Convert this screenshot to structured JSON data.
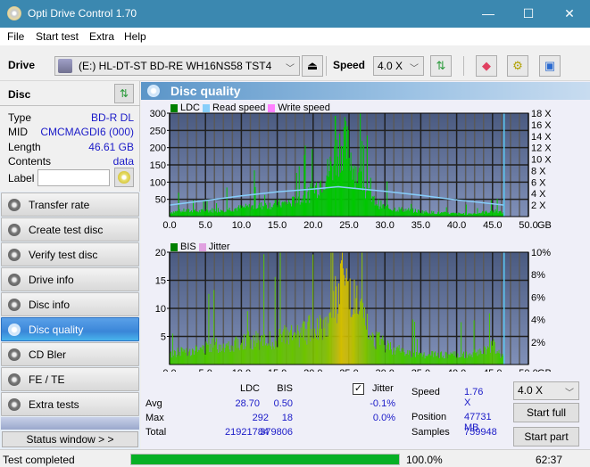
{
  "window": {
    "title": "Opti Drive Control 1.70",
    "minimize": "—",
    "maximize": "☐",
    "close": "✕"
  },
  "menu": [
    "File",
    "Start test",
    "Extra",
    "Help"
  ],
  "toolbar": {
    "drive_label": "Drive",
    "drive_value": "(E:)  HL-DT-ST BD-RE  WH16NS58 TST4",
    "speed_label": "Speed",
    "speed_value": "4.0 X",
    "icons": [
      "eject-icon",
      "refresh-icon",
      "erase-icon",
      "settings-icon",
      "save-icon"
    ]
  },
  "disc": {
    "header": "Disc",
    "fields": [
      {
        "label": "Type",
        "value": "BD-R DL"
      },
      {
        "label": "MID",
        "value": "CMCMAGDI6 (000)"
      },
      {
        "label": "Length",
        "value": "46.61 GB"
      },
      {
        "label": "Contents",
        "value": "data"
      }
    ],
    "label_label": "Label",
    "label_value": ""
  },
  "nav": [
    {
      "label": "Transfer rate",
      "active": false
    },
    {
      "label": "Create test disc",
      "active": false
    },
    {
      "label": "Verify test disc",
      "active": false
    },
    {
      "label": "Drive info",
      "active": false
    },
    {
      "label": "Disc info",
      "active": false
    },
    {
      "label": "Disc quality",
      "active": true
    },
    {
      "label": "CD Bler",
      "active": false
    },
    {
      "label": "FE / TE",
      "active": false
    },
    {
      "label": "Extra tests",
      "active": false
    }
  ],
  "status_window_label": "Status window > >",
  "panel_title": "Disc quality",
  "chart_data": [
    {
      "type": "bar",
      "title": "LDC",
      "legend": [
        {
          "name": "LDC",
          "color": "#008000"
        },
        {
          "name": "Read speed",
          "color": "#87cefa"
        },
        {
          "name": "Write speed",
          "color": "#ff80ff"
        }
      ],
      "xlabel": "GB",
      "x_ticks": [
        "0.0",
        "5.0",
        "10.0",
        "15.0",
        "20.0",
        "25.0",
        "30.0",
        "35.0",
        "40.0",
        "45.0",
        "50.0"
      ],
      "xlim": [
        0,
        50
      ],
      "y_ticks": [
        "50",
        "100",
        "150",
        "200",
        "250",
        "300"
      ],
      "ylim": [
        0,
        300
      ],
      "y2_ticks": [
        "2 X",
        "4 X",
        "6 X",
        "8 X",
        "10 X",
        "12 X",
        "14 X",
        "16 X",
        "18 X"
      ],
      "y2lim": [
        0,
        18
      ],
      "series": [
        {
          "name": "LDC",
          "x": [
            0,
            2,
            4,
            6,
            8,
            10,
            12,
            14,
            16,
            18,
            19,
            20,
            21,
            22,
            23,
            24,
            25,
            26,
            27,
            28,
            30,
            32,
            34,
            36,
            38,
            40,
            42,
            44,
            45,
            46,
            46.6
          ],
          "values": [
            15,
            20,
            18,
            22,
            25,
            30,
            35,
            40,
            45,
            55,
            70,
            90,
            120,
            150,
            200,
            260,
            220,
            150,
            100,
            60,
            30,
            25,
            20,
            15,
            12,
            10,
            10,
            15,
            20,
            15,
            10
          ]
        },
        {
          "name": "Read speed",
          "x": [
            0,
            5,
            10,
            15,
            20,
            23.5,
            25,
            30,
            35,
            40,
            46.6
          ],
          "values": [
            2.0,
            2.8,
            3.6,
            4.3,
            4.8,
            5.2,
            5.0,
            4.4,
            3.7,
            2.9,
            2.0
          ]
        }
      ],
      "peaks": [
        {
          "x": 23,
          "value": 292
        }
      ],
      "end_marker_gb": 46.61
    },
    {
      "type": "bar",
      "title": "BIS",
      "legend": [
        {
          "name": "BIS",
          "color": "#008000"
        },
        {
          "name": "Jitter",
          "color": "#e0a0e0"
        }
      ],
      "xlabel": "GB",
      "x_ticks": [
        "0.0",
        "5.0",
        "10.0",
        "15.0",
        "20.0",
        "25.0",
        "30.0",
        "35.0",
        "40.0",
        "45.0",
        "50.0"
      ],
      "xlim": [
        0,
        50
      ],
      "y_ticks": [
        "5",
        "10",
        "15",
        "20"
      ],
      "ylim": [
        0,
        20
      ],
      "y2_ticks": [
        "2%",
        "4%",
        "6%",
        "8%",
        "10%"
      ],
      "y2lim": [
        0,
        10
      ],
      "series": [
        {
          "name": "BIS",
          "x": [
            0,
            2,
            4,
            6,
            8,
            10,
            12,
            14,
            16,
            18,
            20,
            21,
            22,
            23,
            24,
            25,
            26,
            27,
            28,
            30,
            32,
            34,
            36,
            38,
            40,
            42,
            44,
            45,
            46,
            46.6
          ],
          "values": [
            2,
            3,
            3,
            4,
            4,
            5,
            5,
            5,
            6,
            6,
            8,
            8,
            9,
            13,
            17,
            15,
            12,
            9,
            6,
            4,
            3,
            2,
            2,
            2,
            2,
            2,
            3,
            4,
            2,
            2
          ]
        }
      ],
      "end_marker_gb": 46.61
    }
  ],
  "stats": {
    "columns": [
      "LDC",
      "BIS"
    ],
    "rows": [
      {
        "label": "Avg",
        "ldc": "28.70",
        "bis": "0.50"
      },
      {
        "label": "Max",
        "ldc": "292",
        "bis": "18"
      },
      {
        "label": "Total",
        "ldc": "21921784",
        "bis": "379806"
      }
    ],
    "jitter_label": "Jitter",
    "jitter_checked": true,
    "jitter_avg": "-0.1%",
    "jitter_max": "0.0%",
    "speed_label": "Speed",
    "speed_value": "1.76 X",
    "position_label": "Position",
    "position_value": "47731 MB",
    "samples_label": "Samples",
    "samples_value": "759948",
    "speed_select": "4.0 X",
    "start_full": "Start full",
    "start_part": "Start part"
  },
  "statusbar": {
    "text": "Test completed",
    "progress": 100.0,
    "progress_label": "100.0%",
    "time": "62:37"
  }
}
